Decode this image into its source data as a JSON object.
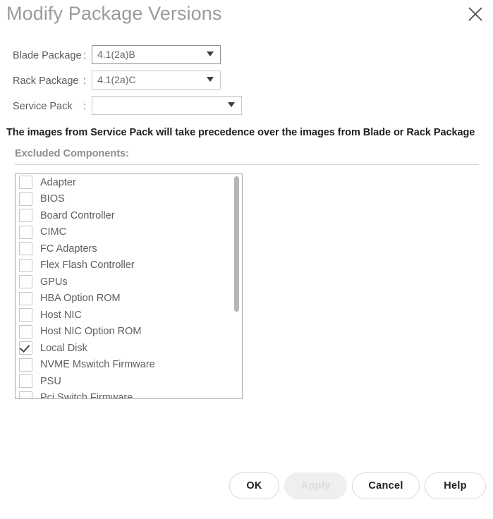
{
  "dialog": {
    "title": "Modify Package Versions",
    "close_icon": "close-icon"
  },
  "form": {
    "colon": ":",
    "rows": [
      {
        "label": "Blade Package",
        "value": "4.1(2a)B",
        "focused": true
      },
      {
        "label": "Rack Package",
        "value": "4.1(2a)C",
        "focused": false
      },
      {
        "label": "Service Pack",
        "value": "",
        "focused": false
      }
    ]
  },
  "notice": "The images from Service Pack will take precedence over the images from Blade or Rack Package",
  "excluded": {
    "label": "Excluded Components:",
    "items": [
      {
        "label": "Adapter",
        "checked": false
      },
      {
        "label": "BIOS",
        "checked": false
      },
      {
        "label": "Board Controller",
        "checked": false
      },
      {
        "label": "CIMC",
        "checked": false
      },
      {
        "label": "FC Adapters",
        "checked": false
      },
      {
        "label": "Flex Flash Controller",
        "checked": false
      },
      {
        "label": "GPUs",
        "checked": false
      },
      {
        "label": "HBA Option ROM",
        "checked": false
      },
      {
        "label": "Host NIC",
        "checked": false
      },
      {
        "label": "Host NIC Option ROM",
        "checked": false
      },
      {
        "label": "Local Disk",
        "checked": true
      },
      {
        "label": "NVME Mswitch Firmware",
        "checked": false
      },
      {
        "label": "PSU",
        "checked": false
      },
      {
        "label": "Pci Switch Firmware",
        "checked": false
      }
    ]
  },
  "footer": {
    "ok": "OK",
    "apply": "Apply",
    "cancel": "Cancel",
    "help": "Help"
  },
  "colors": {
    "title": "#9b9b9b",
    "notice": "#1f1f1f",
    "border": "#a8adb1",
    "disabled_button_bg": "#efefef"
  }
}
